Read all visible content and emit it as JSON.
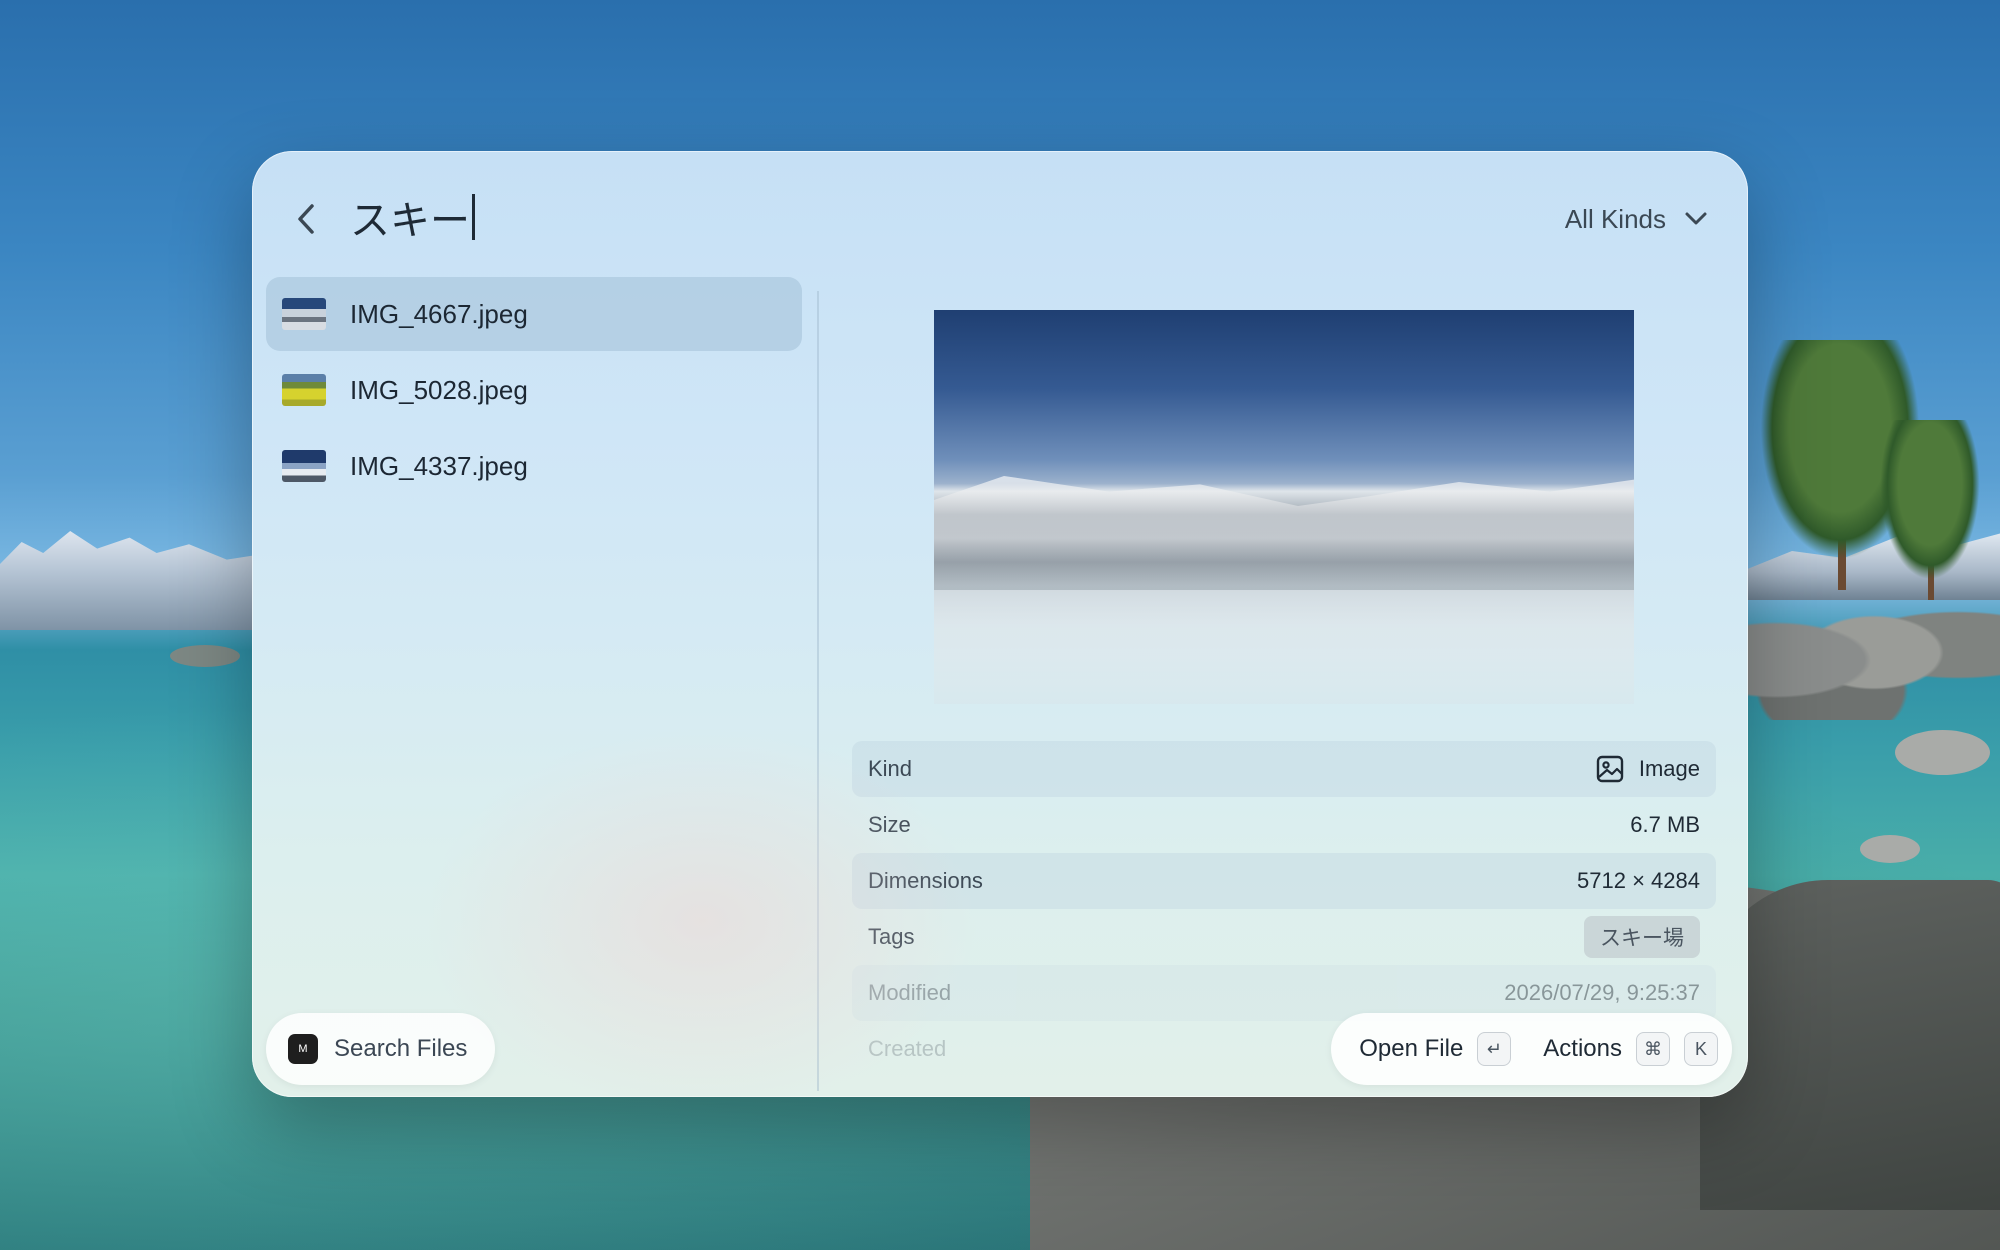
{
  "search": {
    "query": "スキー",
    "kind_filter": "All Kinds"
  },
  "results": [
    {
      "name": "IMG_4667.jpeg",
      "selected": true
    },
    {
      "name": "IMG_5028.jpeg",
      "selected": false
    },
    {
      "name": "IMG_4337.jpeg",
      "selected": false
    }
  ],
  "details": {
    "kind": {
      "label": "Kind",
      "value": "Image"
    },
    "size": {
      "label": "Size",
      "value": "6.7 MB"
    },
    "dimensions": {
      "label": "Dimensions",
      "value": "5712 × 4284"
    },
    "tags": {
      "label": "Tags",
      "value": "スキー場"
    },
    "modified": {
      "label": "Modified",
      "value": "2026/07/29, 9:25:37"
    },
    "created": {
      "label": "Created"
    }
  },
  "footer": {
    "search_files_label": "Search Files",
    "app_icon_letter": "M",
    "open_file_label": "Open File",
    "open_file_key": "↵",
    "actions_label": "Actions",
    "actions_key_1": "⌘",
    "actions_key_2": "K"
  },
  "icons": [
    "back-chevron-icon",
    "chevron-down-icon",
    "image-icon",
    "return-key-icon",
    "command-key-icon"
  ]
}
